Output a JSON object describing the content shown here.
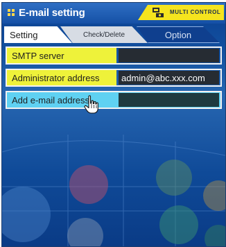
{
  "window": {
    "title": "E-mail setting",
    "badge_text": "MULTI CONTROL"
  },
  "tabs": [
    {
      "label": "Setting",
      "active": true
    },
    {
      "label": "Check/Delete",
      "active": false
    },
    {
      "label": "Option",
      "active": false
    }
  ],
  "settings": [
    {
      "label": "SMTP server",
      "value": ""
    },
    {
      "label": "Administrator address",
      "value": "admin@abc.xxx.com"
    },
    {
      "label": "Add e-mail address",
      "value": ""
    }
  ],
  "colors": {
    "panel_blue": "#1550a6",
    "row_yellow": "#eef23a",
    "row_cyan": "#5fd1f2",
    "badge_yellow": "#f5e41e",
    "value_dark": "#262c33"
  },
  "icons": [
    "grid-icon",
    "multi-control-icon",
    "hand-cursor-icon"
  ]
}
